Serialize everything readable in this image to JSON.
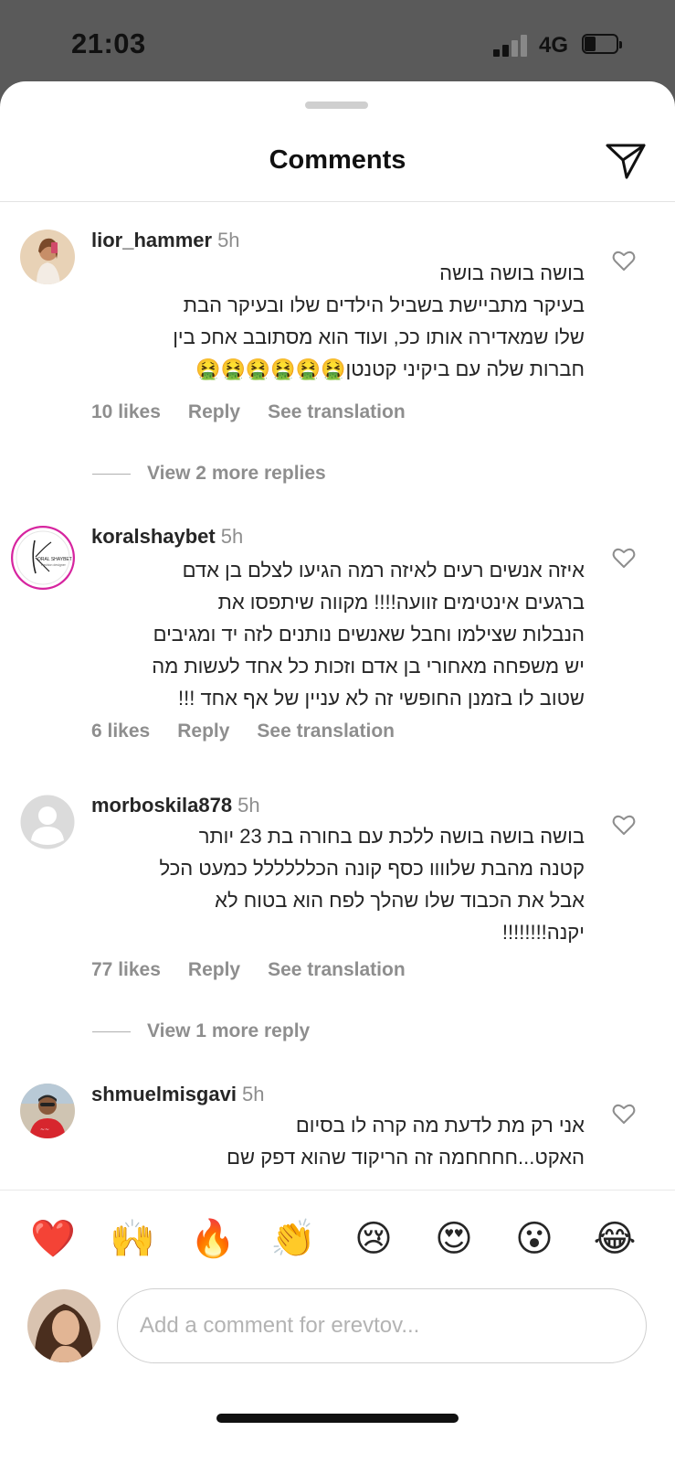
{
  "status_bar": {
    "time": "21:03",
    "network": "4G"
  },
  "header": {
    "title": "Comments"
  },
  "comments": [
    {
      "username": "lior_hammer",
      "time": "5h",
      "lines": [
        "בושה בושה בושה",
        "בעיקר מתביישת בשביל הילדים שלו ובעיקר הבת",
        "שלו שמאדירה אותו ככ, ועוד הוא מסתובב אחכ בין",
        "חברות שלה עם ביקיני קטנטן🤮🤮🤮🤮🤮🤮"
      ],
      "likes": "10 likes",
      "reply": "Reply",
      "translate": "See translation",
      "view_replies": "View 2 more replies"
    },
    {
      "username": "koralshaybet",
      "time": "5h",
      "lines": [
        "איזה אנשים רעים לאיזה רמה הגיעו לצלם בן אדם",
        "ברגעים אינטימים זוועה!!!! מקווה שיתפסו את",
        "הנבלות שצילמו וחבל שאנשים נותנים לזה יד ומגיבים",
        "יש משפחה מאחורי בן אדם וזכות כל אחד לעשות מה",
        "שטוב לו בזמנן החופשי זה לא עניין של אף אחד !!!"
      ],
      "likes": "6 likes",
      "reply": "Reply",
      "translate": "See translation",
      "avatar_text_1": "ORAL SHAYBET",
      "avatar_text_2": "Fashion designer"
    },
    {
      "username": "morboskila878",
      "time": "5h",
      "lines": [
        "בושה בושה בושה ללכת עם בחורה בת 23 יותר",
        "קטנה מהבת שלוווו כסף קונה הכלללללל כמעט הכל",
        "אבל את הכבוד שלו שהלך לפח הוא בטוח לא",
        "יקנה!!!!!!!!"
      ],
      "likes": "77 likes",
      "reply": "Reply",
      "translate": "See translation",
      "view_replies": "View 1 more reply"
    },
    {
      "username": "shmuelmisgavi",
      "time": "5h",
      "lines": [
        "אני רק מת לדעת מה קרה לו בסיום",
        "האקט...חחחחמה זה הריקוד שהוא דפק שם"
      ]
    }
  ],
  "reactions": [
    "❤️",
    "🙌",
    "🔥",
    "👏",
    "😢",
    "😍",
    "😮",
    "😂"
  ],
  "input": {
    "placeholder": "Add a comment for erevtov..."
  },
  "colors": {
    "text": "#262626",
    "secondary": "#8e8e8e",
    "like_red": "#ed4956"
  }
}
